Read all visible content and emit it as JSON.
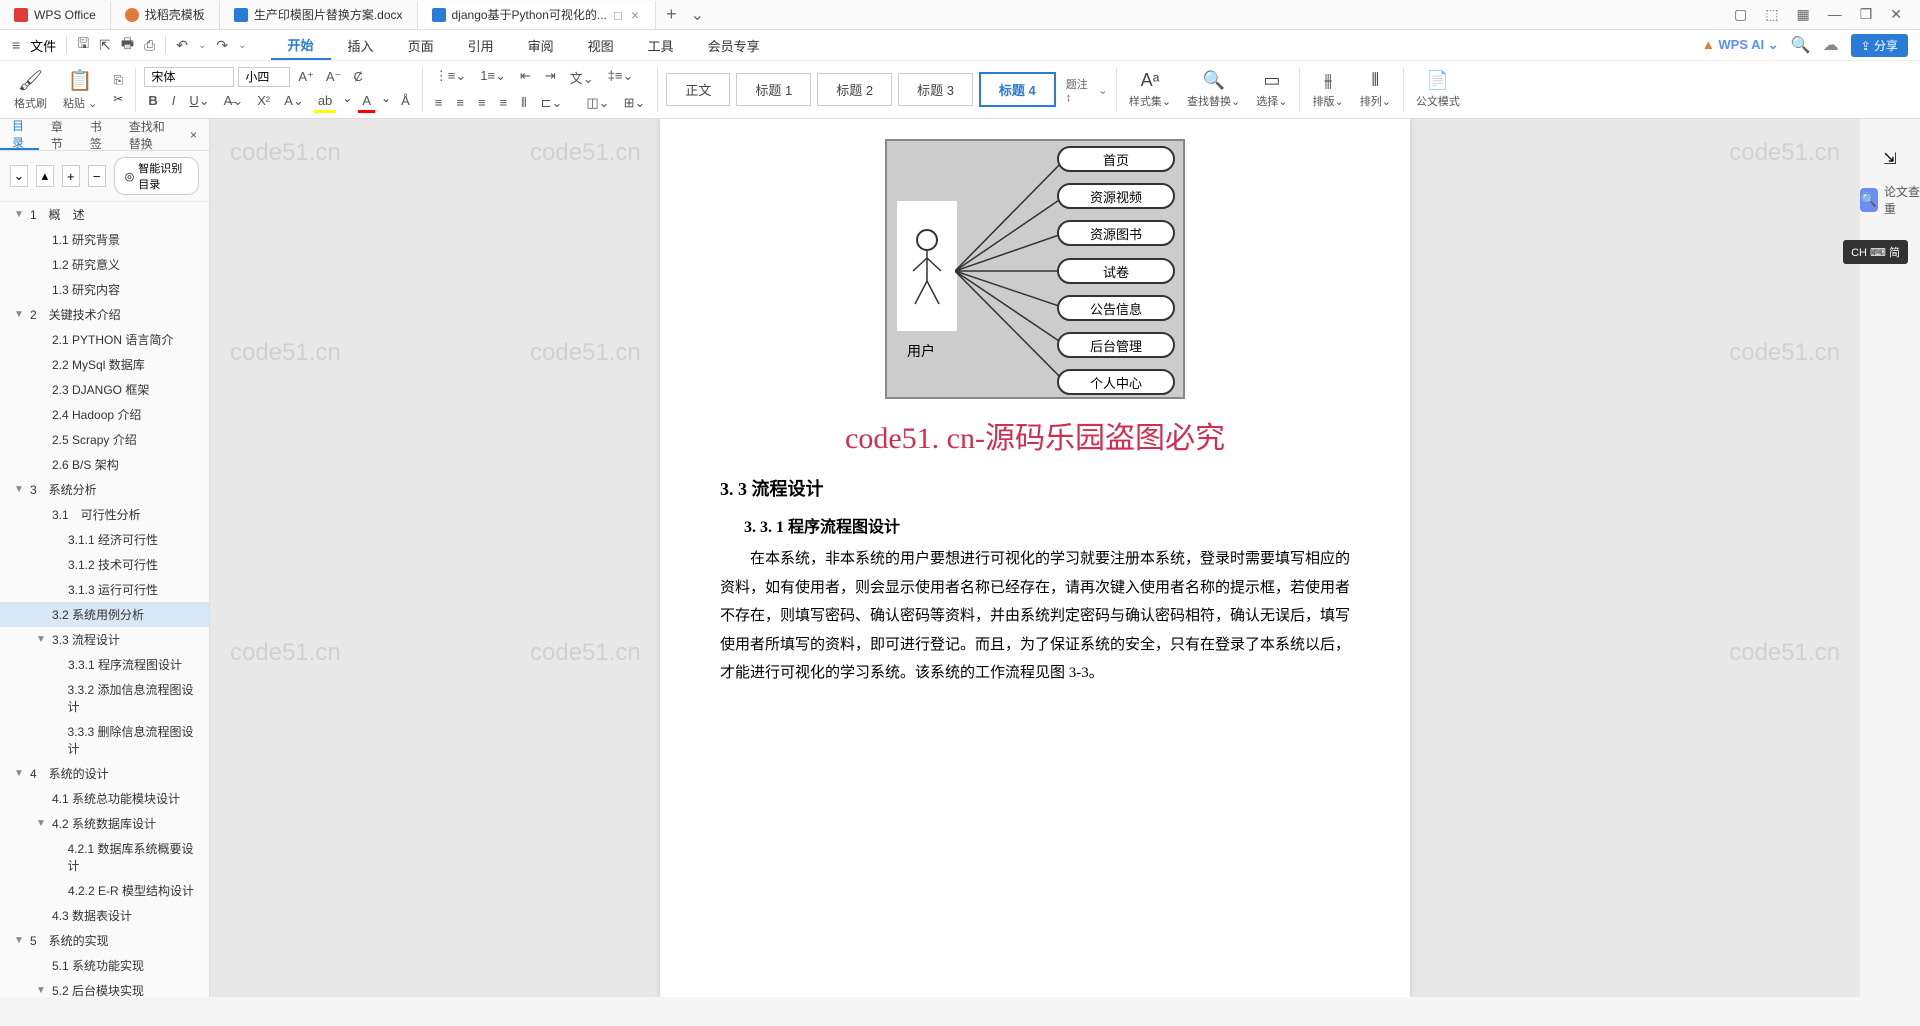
{
  "titlebar": {
    "tabs": [
      {
        "icon": "wps",
        "label": "WPS Office"
      },
      {
        "icon": "dao",
        "label": "找稻壳模板"
      },
      {
        "icon": "word",
        "label": "生产印模图片替换方案.docx"
      },
      {
        "icon": "word",
        "label": "django基于Python可视化的..."
      }
    ],
    "add": "+",
    "dd": "⌄"
  },
  "filerow": {
    "menu": "≡",
    "file": "文件"
  },
  "menubar": {
    "items": [
      "开始",
      "插入",
      "页面",
      "引用",
      "审阅",
      "视图",
      "工具",
      "会员专享"
    ],
    "wpsai": "WPS AI",
    "share": "分享"
  },
  "ribbon": {
    "format_painter": "格式刷",
    "paste": "粘贴",
    "font": "宋体",
    "size": "小四",
    "styles": [
      "正文",
      "标题 1",
      "标题 2",
      "标题 3",
      "标题 4"
    ],
    "title_note": "题注",
    "style_center": "样式集",
    "find_replace": "查找替换",
    "select": "选择",
    "sort": "排版",
    "align": "排列",
    "gongwen": "公文模式"
  },
  "side": {
    "tabs": [
      "目录",
      "章节",
      "书签",
      "查找和替换"
    ],
    "smart": "智能识别目录"
  },
  "toc": [
    {
      "l": 1,
      "t": "1　概　述",
      "exp": "▼"
    },
    {
      "l": 2,
      "t": "1.1 研究背景"
    },
    {
      "l": 2,
      "t": "1.2 研究意义"
    },
    {
      "l": 2,
      "t": "1.3 研究内容"
    },
    {
      "l": 1,
      "t": "2　关键技术介绍",
      "exp": "▼"
    },
    {
      "l": 2,
      "t": "2.1 PYTHON 语言简介"
    },
    {
      "l": 2,
      "t": "2.2 MySql 数据库"
    },
    {
      "l": 2,
      "t": "2.3 DJANGO 框架"
    },
    {
      "l": 2,
      "t": "2.4 Hadoop 介绍"
    },
    {
      "l": 2,
      "t": "2.5 Scrapy 介绍"
    },
    {
      "l": 2,
      "t": "2.6 B/S 架构"
    },
    {
      "l": 1,
      "t": "3　系统分析",
      "exp": "▼"
    },
    {
      "l": 2,
      "t": "3.1　可行性分析"
    },
    {
      "l": 3,
      "t": "3.1.1 经济可行性"
    },
    {
      "l": 3,
      "t": "3.1.2 技术可行性"
    },
    {
      "l": 3,
      "t": "3.1.3 运行可行性"
    },
    {
      "l": 2,
      "t": "3.2 系统用例分析",
      "sel": true
    },
    {
      "l": 2,
      "t": "3.3 流程设计",
      "exp": "▼"
    },
    {
      "l": 3,
      "t": "3.3.1 程序流程图设计"
    },
    {
      "l": 3,
      "t": "3.3.2 添加信息流程图设计"
    },
    {
      "l": 3,
      "t": "3.3.3 删除信息流程图设计"
    },
    {
      "l": 1,
      "t": "4　系统的设计",
      "exp": "▼"
    },
    {
      "l": 2,
      "t": "4.1 系统总功能模块设计"
    },
    {
      "l": 2,
      "t": "4.2 系统数据库设计",
      "exp": "▼"
    },
    {
      "l": 3,
      "t": "4.2.1 数据库系统概要设计"
    },
    {
      "l": 3,
      "t": "4.2.2 E-R 模型结构设计"
    },
    {
      "l": 2,
      "t": "4.3 数据表设计"
    },
    {
      "l": 1,
      "t": "5　系统的实现",
      "exp": "▼"
    },
    {
      "l": 2,
      "t": "5.1 系统功能实现"
    },
    {
      "l": 2,
      "t": "5.2 后台模块实现",
      "exp": "▼"
    }
  ],
  "doc": {
    "diagram": {
      "user": "用户",
      "items": [
        "首页",
        "资源视频",
        "资源图书",
        "试卷",
        "公告信息",
        "后台管理",
        "个人中心"
      ]
    },
    "watermark_text": "code51. cn-源码乐园盗图必究",
    "h3": "3. 3 流程设计",
    "h4": "3. 3. 1 程序流程图设计",
    "body": "在本系统，非本系统的用户要想进行可视化的学习就要注册本系统，登录时需要填写相应的资料，如有使用者，则会显示使用者名称已经存在，请再次键入使用者名称的提示框，若使用者不存在，则填写密码、确认密码等资料，并由系统判定密码与确认密码相符，确认无误后，填写使用者所填写的资料，即可进行登记。而且，为了保证系统的安全，只有在登录了本系统以后，才能进行可视化的学习系统。该系统的工作流程见图 3-3。",
    "bg_wm": "code51.cn"
  },
  "right": {
    "check": "论文查重"
  },
  "lang": "CH ⌨ 简"
}
